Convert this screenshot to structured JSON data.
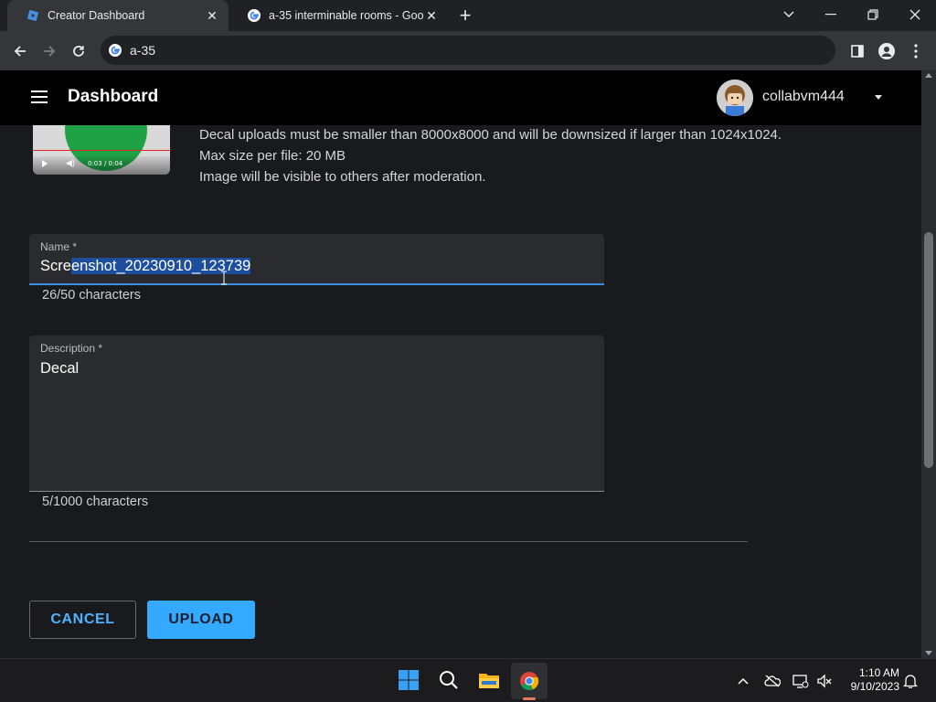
{
  "browser": {
    "tabs": [
      {
        "title": "Creator Dashboard",
        "active": true
      },
      {
        "title": "a-35 interminable rooms - Goog",
        "active": false
      }
    ],
    "omnibox_text": "a-35"
  },
  "appbar": {
    "title": "Dashboard",
    "username": "collabvm444"
  },
  "thumbnail": {
    "time": "0:03 / 0:04"
  },
  "info": {
    "line1": "Decal uploads must be smaller than 8000x8000 and will be downsized if larger than 1024x1024.",
    "line2": "Max size per file: 20 MB",
    "line3": "Image will be visible to others after moderation."
  },
  "form": {
    "name_label": "Name *",
    "name_value_before": "Scre",
    "name_value_selected": "enshot_20230910_123739",
    "name_counter": "26/50 characters",
    "desc_label": "Description *",
    "desc_value": "Decal",
    "desc_counter": "5/1000 characters"
  },
  "buttons": {
    "cancel": "CANCEL",
    "upload": "UPLOAD"
  },
  "taskbar": {
    "time": "1:10 AM",
    "date": "9/10/2023"
  },
  "colors": {
    "accent": "#33aaff",
    "selection": "#1d4e9e",
    "app_bar": "#000000",
    "page_bg": "#191a1d"
  }
}
